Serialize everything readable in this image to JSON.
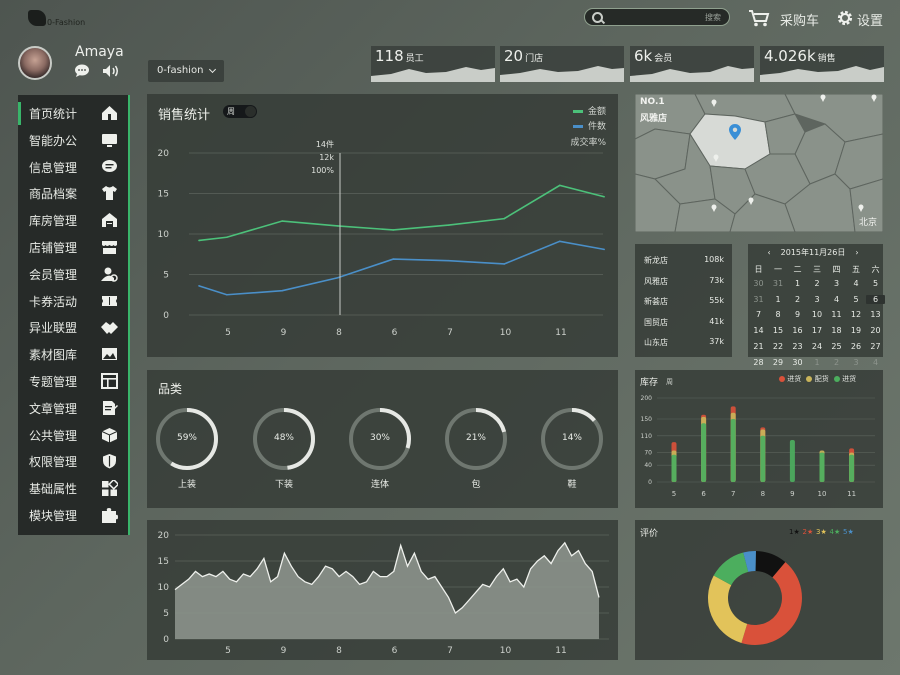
{
  "topbar": {
    "logo_text": "0-Fashion",
    "search_placeholder": "搜索",
    "cart_label": "采购车",
    "settings_label": "设置"
  },
  "user": {
    "name": "Amaya"
  },
  "store_select": {
    "value": "0-fashion"
  },
  "kpis": [
    {
      "value": "118",
      "unit": "员工"
    },
    {
      "value": "20",
      "unit": "门店"
    },
    {
      "value": "6k",
      "unit": "会员"
    },
    {
      "value": "4.026k",
      "unit": "销售"
    }
  ],
  "sidebar": {
    "items": [
      {
        "label": "首页统计",
        "icon": "home-icon",
        "active": true
      },
      {
        "label": "智能办公",
        "icon": "monitor-icon"
      },
      {
        "label": "信息管理",
        "icon": "message-icon"
      },
      {
        "label": "商品档案",
        "icon": "shirt-icon"
      },
      {
        "label": "库房管理",
        "icon": "warehouse-icon"
      },
      {
        "label": "店铺管理",
        "icon": "shop-icon"
      },
      {
        "label": "会员管理",
        "icon": "member-icon"
      },
      {
        "label": "卡券活动",
        "icon": "ticket-icon"
      },
      {
        "label": "异业联盟",
        "icon": "handshake-icon"
      },
      {
        "label": "素材图库",
        "icon": "image-icon"
      },
      {
        "label": "专题管理",
        "icon": "layout-icon"
      },
      {
        "label": "文章管理",
        "icon": "document-icon"
      },
      {
        "label": "公共管理",
        "icon": "cube-icon"
      },
      {
        "label": "权限管理",
        "icon": "shield-icon"
      },
      {
        "label": "基础属性",
        "icon": "grid-icon"
      },
      {
        "label": "模块管理",
        "icon": "puzzle-icon"
      }
    ]
  },
  "sales_panel": {
    "title": "销售统计",
    "toggle_label": "周",
    "legend": [
      {
        "label": "金额",
        "color": "#4cc17a"
      },
      {
        "label": "件数",
        "color": "#4a8fc8"
      }
    ],
    "extra_label": "成交率%",
    "tooltip": {
      "line1": "14件",
      "line2": "12k",
      "line3": "100%"
    }
  },
  "map_panel": {
    "rank": "NO.1",
    "store": "风雅店",
    "city": "北京"
  },
  "store_list": [
    {
      "name": "新龙店",
      "value": "108k"
    },
    {
      "name": "风雅店",
      "value": "73k"
    },
    {
      "name": "新荟店",
      "value": "55k"
    },
    {
      "name": "国贸店",
      "value": "41k"
    },
    {
      "name": "山东店",
      "value": "37k"
    }
  ],
  "calendar": {
    "title": "2015年11月26日",
    "prev": "‹",
    "next": "›",
    "weekdays": [
      "日",
      "一",
      "二",
      "三",
      "四",
      "五",
      "六"
    ],
    "days": [
      [
        "30",
        "31",
        "1",
        "2",
        "3",
        "4",
        "5"
      ],
      [
        "31",
        "1",
        "2",
        "3",
        "4",
        "5",
        "6"
      ],
      [
        "7",
        "8",
        "9",
        "10",
        "11",
        "12",
        "13"
      ],
      [
        "14",
        "15",
        "16",
        "17",
        "18",
        "19",
        "20"
      ],
      [
        "21",
        "22",
        "23",
        "24",
        "25",
        "26",
        "27"
      ],
      [
        "28",
        "29",
        "30",
        "1",
        "2",
        "3",
        "4"
      ]
    ],
    "selected": "6"
  },
  "category_panel": {
    "title": "品类",
    "items": [
      {
        "label": "上装",
        "pct": "59%",
        "value": 59
      },
      {
        "label": "下装",
        "pct": "48%",
        "value": 48
      },
      {
        "label": "连体",
        "pct": "30%",
        "value": 30
      },
      {
        "label": "包",
        "pct": "21%",
        "value": 21
      },
      {
        "label": "鞋",
        "pct": "14%",
        "value": 14
      }
    ]
  },
  "inventory_panel": {
    "title": "库存",
    "subtitle": "周",
    "legend": [
      {
        "label": "进货",
        "color": "#d9513a"
      },
      {
        "label": "配货",
        "color": "#c9b45a"
      },
      {
        "label": "进货",
        "color": "#4cae5e"
      }
    ]
  },
  "rating_panel": {
    "title": "评价",
    "legend": [
      {
        "label": "1★",
        "color": "#111111"
      },
      {
        "label": "2★",
        "color": "#d9513a"
      },
      {
        "label": "3★",
        "color": "#e2c35a"
      },
      {
        "label": "4★",
        "color": "#4cae5e"
      },
      {
        "label": "5★",
        "color": "#4a8fc8"
      }
    ]
  },
  "chart_data": [
    {
      "type": "line",
      "title": "销售统计",
      "x": [
        "",
        "5",
        "9",
        "8",
        "6",
        "7",
        "10",
        "11",
        ""
      ],
      "ylim": [
        0,
        20
      ],
      "yticks": [
        0,
        5,
        10,
        15,
        20
      ],
      "series": [
        {
          "name": "金额",
          "color": "#4cc17a",
          "values": [
            9.2,
            9.6,
            11.6,
            11.0,
            10.5,
            11.1,
            11.9,
            16.0,
            14.6
          ]
        },
        {
          "name": "件数",
          "color": "#4a8fc8",
          "values": [
            3.6,
            2.5,
            3.0,
            4.6,
            6.9,
            6.7,
            6.3,
            9.1,
            8.1
          ]
        }
      ],
      "x_index": [
        0,
        0.5,
        1.5,
        2.5,
        3.5,
        4.5,
        5.5,
        6.5,
        7.3
      ]
    },
    {
      "type": "bar",
      "title": "库存",
      "categories": [
        "5",
        "6",
        "7",
        "8",
        "9",
        "10",
        "11"
      ],
      "ylim": [
        0,
        200
      ],
      "yticks": [
        0,
        40,
        70,
        110,
        150,
        200
      ],
      "series": [
        {
          "name": "进货",
          "color": "#d9513a",
          "values": [
            95,
            160,
            180,
            130,
            0,
            0,
            80
          ]
        },
        {
          "name": "配货",
          "color": "#c9b45a",
          "values": [
            75,
            155,
            165,
            125,
            0,
            75,
            70
          ]
        },
        {
          "name": "进货",
          "color": "#4cae5e",
          "values": [
            65,
            140,
            150,
            110,
            100,
            70,
            65
          ]
        }
      ]
    },
    {
      "type": "area",
      "x": [
        "5",
        "9",
        "8",
        "6",
        "7",
        "10",
        "11"
      ],
      "ylim": [
        0,
        20
      ],
      "yticks": [
        0,
        5,
        10,
        15,
        20
      ],
      "values": [
        9.5,
        10.5,
        11.5,
        13,
        12,
        12.5,
        12,
        13,
        11.5,
        11,
        12.5,
        12,
        13.5,
        15.5,
        11,
        12,
        16.5,
        14,
        12,
        11,
        10.5,
        12,
        14,
        13.5,
        12,
        13,
        12,
        10.5,
        11,
        13,
        12,
        12,
        13,
        18,
        14,
        16.5,
        13,
        11.5,
        12,
        10,
        8,
        5,
        6,
        7.5,
        9,
        10.5,
        10,
        12,
        13.5,
        11,
        11.5,
        10,
        13.5,
        15,
        16,
        14.5,
        17,
        18.5,
        16,
        17,
        14.5,
        13,
        8
      ]
    },
    {
      "type": "pie",
      "title": "评价",
      "categories": [
        "1★",
        "2★",
        "3★",
        "4★",
        "5★"
      ],
      "values": [
        10,
        40,
        26,
        12,
        4
      ]
    }
  ]
}
